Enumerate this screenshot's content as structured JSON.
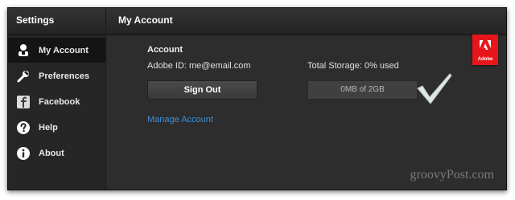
{
  "sidebar": {
    "title": "Settings",
    "items": [
      {
        "label": "My Account",
        "icon": "user-icon",
        "active": true
      },
      {
        "label": "Preferences",
        "icon": "wrench-icon",
        "active": false
      },
      {
        "label": "Facebook",
        "icon": "facebook-icon",
        "active": false
      },
      {
        "label": "Help",
        "icon": "help-icon",
        "active": false
      },
      {
        "label": "About",
        "icon": "info-icon",
        "active": false
      }
    ]
  },
  "main": {
    "title": "My Account",
    "section_title": "Account",
    "adobe_id": "Adobe ID: me@email.com",
    "total_storage": "Total Storage: 0% used",
    "sign_out_label": "Sign Out",
    "storage_bar_text": "0MB of 2GB",
    "storage_used_fraction": 0,
    "manage_account_label": "Manage Account"
  },
  "logo": {
    "brand": "Adobe",
    "color": "#e8161a"
  },
  "watermark": "groovyPost.com",
  "colors": {
    "link": "#3e8fd8",
    "accent": "#e8161a",
    "checkmark": "#dfe8e8"
  }
}
